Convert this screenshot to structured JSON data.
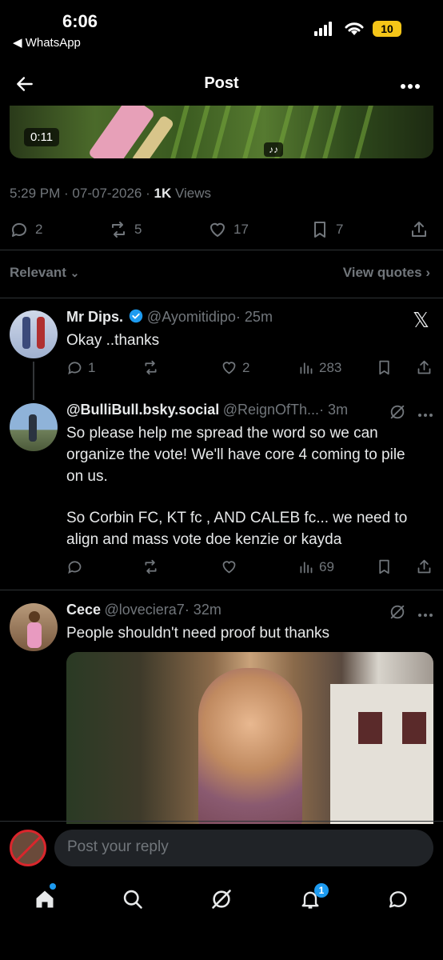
{
  "status_bar": {
    "time": "6:06",
    "back_app": "◀ WhatsApp",
    "battery": "10"
  },
  "header": {
    "title": "Post"
  },
  "media": {
    "duration": "0:11",
    "music_badge": "♪♪"
  },
  "post_meta": {
    "time": "5:29 PM",
    "date": "07-07-2026",
    "views_count": "1K",
    "views_label": "Views"
  },
  "post_stats": {
    "replies": "2",
    "reposts": "5",
    "likes": "17",
    "bookmarks": "7"
  },
  "filter": {
    "sort_label": "Relevant",
    "view_quotes": "View quotes"
  },
  "replies": [
    {
      "name": "Mr Dips.",
      "handle": "@Ayomitidipo",
      "time": "· 25m",
      "text": "Okay ..thanks",
      "reply_count": "1",
      "repost_count": "",
      "like_count": "2",
      "views": "283"
    },
    {
      "name": "@BulliBull.bsky.social",
      "handle": "@ReignOfTh...",
      "time": "· 3m",
      "text_p1": "So please help me spread the word so we can organize the vote!  We'll have core 4 coming to pile on us.",
      "text_p2": "So Corbin FC, KT fc , AND CALEB fc... we need to align and mass vote doe kenzie or kayda",
      "reply_count": "",
      "repost_count": "",
      "like_count": "",
      "views": "69"
    },
    {
      "name": "Cece",
      "handle": "@loveciera7",
      "time": "· 32m",
      "text": "People shouldn't need proof but thanks"
    }
  ],
  "composer": {
    "placeholder": "Post your reply"
  },
  "tabbar": {
    "notification_badge": "1"
  },
  "colors": {
    "background": "#000000",
    "text": "#e7e9ea",
    "muted": "#71767b",
    "accent": "#1d9bf0",
    "divider": "#2f3336"
  }
}
